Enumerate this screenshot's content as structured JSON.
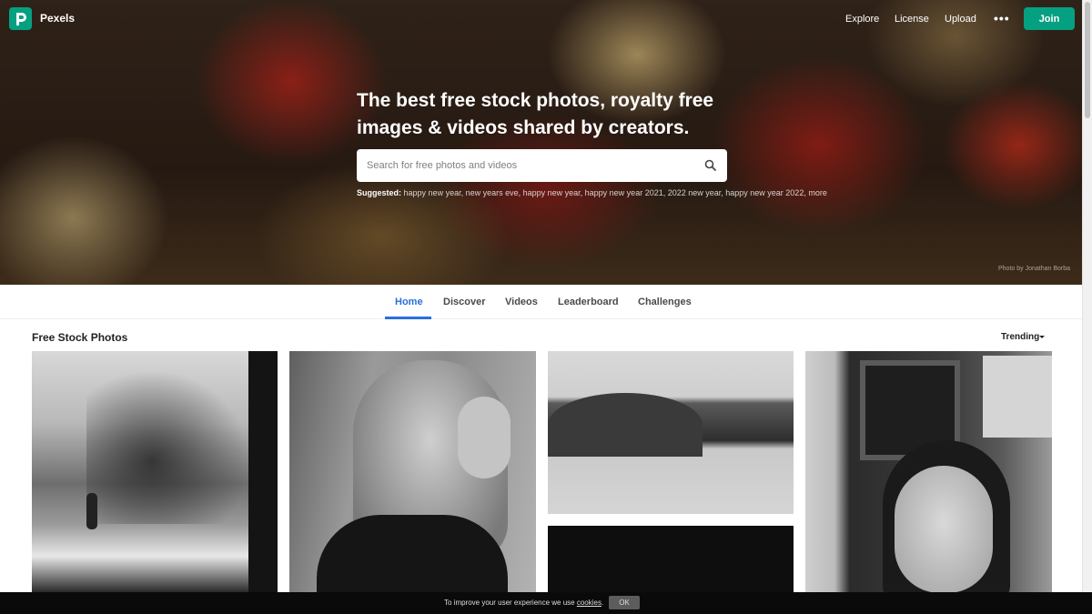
{
  "header": {
    "brand": "Pexels",
    "nav": {
      "explore": "Explore",
      "license": "License",
      "upload": "Upload"
    },
    "more_icon": "ellipsis-icon",
    "join_label": "Join",
    "brand_color": "#05a081"
  },
  "hero": {
    "headline": "The best free stock photos, royalty free images & videos shared by creators.",
    "search_placeholder": "Search for free photos and videos",
    "search_icon": "search-icon",
    "suggested_label": "Suggested:",
    "suggested_terms": "happy new year, new years eve, happy new year, happy new year 2021, 2022 new year, happy new year 2022, more",
    "photo_credit": "Photo by Jonathan Borba"
  },
  "tabs": {
    "home": "Home",
    "discover": "Discover",
    "videos": "Videos",
    "leaderboard": "Leaderboard",
    "challenges": "Challenges",
    "active_color": "#2a6fdb"
  },
  "main": {
    "section_title": "Free Stock Photos",
    "sort_label": "Trending"
  },
  "cookie": {
    "text_before": "To improve your user experience we use ",
    "link": "cookies",
    "text_after": ".",
    "ok_label": "OK"
  }
}
